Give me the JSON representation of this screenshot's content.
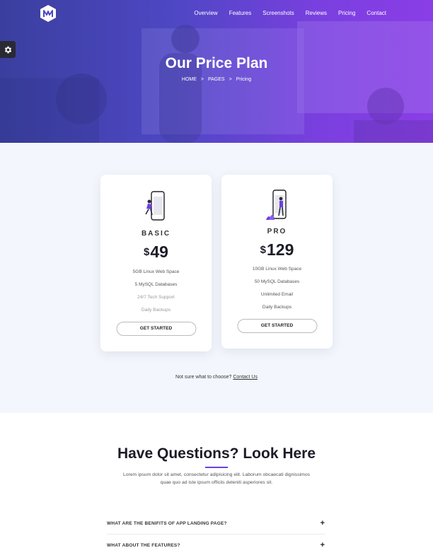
{
  "nav": {
    "items": [
      "Overview",
      "Features",
      "Screenshots",
      "Reviews",
      "Pricing",
      "Contact"
    ]
  },
  "hero": {
    "title": "Our Price Plan",
    "breadcrumb": [
      "HOME",
      "PAGES",
      "Pricing"
    ],
    "separator": ">"
  },
  "plans": [
    {
      "name": "BASIC",
      "currency": "$",
      "price": "49",
      "features": [
        "5GB Linux Web Space",
        "5 MySQL Databases",
        "24/7 Tech Support",
        "Daily Backups"
      ],
      "button": "GET STARTED"
    },
    {
      "name": "PRO",
      "currency": "$",
      "price": "129",
      "features": [
        "10GB Linux Web Space",
        "50 MySQL Databases",
        "Unlimited Email",
        "Daily Backups"
      ],
      "button": "GET STARTED"
    }
  ],
  "help": {
    "text": "Not sure what to choose?",
    "link": "Contact Us"
  },
  "faq": {
    "title": "Have Questions? Look Here",
    "description_line1": "Lorem ipsum dolor sit amet, consectetur adipisicing elit. Laborum obcaecati dignissimos",
    "description_line2": "quae quo ad iste ipsum officiis deleniti asperiores sit.",
    "items": [
      {
        "question": "WHAT ARE THE BENIFITS OF APP LANDING PAGE?",
        "icon": "+"
      },
      {
        "question": "WHAT ABOUT THE FEATURES?",
        "icon": "+"
      }
    ]
  },
  "colors": {
    "accent": "#6c3fe0",
    "hero_start": "#3a3f9e",
    "hero_end": "#8a3ee6",
    "section_bg": "#f3f6fc"
  }
}
